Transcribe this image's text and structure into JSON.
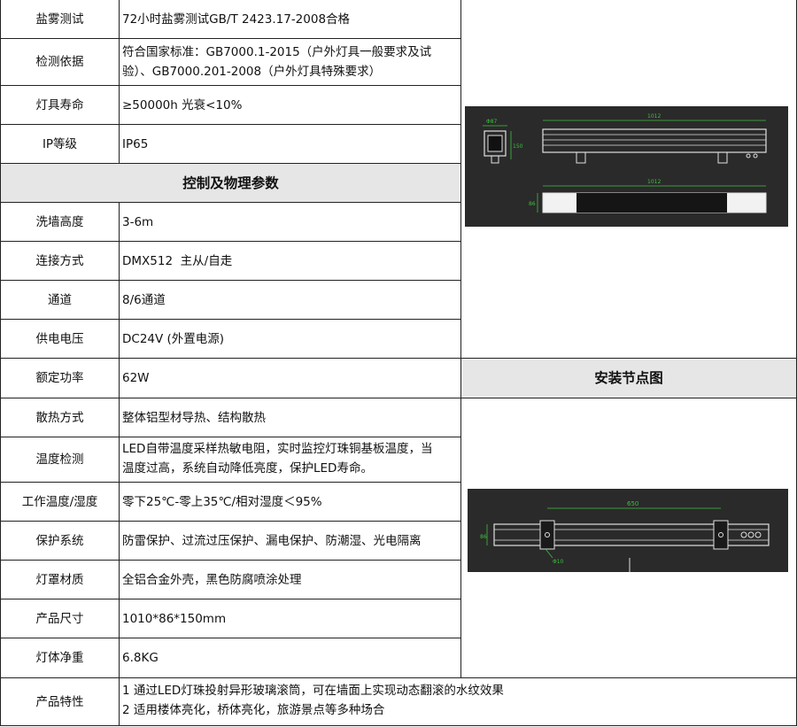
{
  "rows_top": [
    {
      "label": "盐雾测试",
      "value": "72小时盐雾测试GB/T 2423.17-2008合格"
    },
    {
      "label": "检测依据",
      "value_lines": [
        "符合国家标准：GB7000.1-2015（户外灯具一般要求及试",
        "验）、GB7000.201-2008（户外灯具特殊要求）"
      ]
    },
    {
      "label": "灯具寿命",
      "value": "≥50000h 光衰<10%"
    },
    {
      "label": "IP等级",
      "value": "IP65"
    }
  ],
  "section_control": "控制及物理参数",
  "rows_control": [
    {
      "label": "洗墙高度",
      "value": "3-6m"
    },
    {
      "label": "连接方式",
      "value": "DMX512  主从/自走"
    },
    {
      "label": "通道",
      "value": "8/6通道"
    },
    {
      "label": "供电电压",
      "value": "DC24V (外置电源)"
    },
    {
      "label": "额定功率",
      "value": "62W"
    },
    {
      "label": "散热方式",
      "value": "整体铝型材导热、结构散热"
    },
    {
      "label": "温度检测",
      "value_lines": [
        "LED自带温度采样热敏电阻，实时监控灯珠铜基板温度，当",
        "温度过高，系统自动降低亮度，保护LED寿命。"
      ]
    },
    {
      "label": "工作温度/湿度",
      "value": "零下25℃-零上35℃/相对湿度＜95%"
    },
    {
      "label": "保护系统",
      "value": "防雷保护、过流过压保护、漏电保护、防潮湿、光电隔离"
    },
    {
      "label": "灯罩材质",
      "value": "全铝合金外壳，黑色防腐喷涂处理"
    },
    {
      "label": "产品尺寸",
      "value": "1010*86*150mm"
    },
    {
      "label": "灯体净重",
      "value": "6.8KG"
    }
  ],
  "row_features": {
    "label": "产品特性",
    "value_lines": [
      "1 通过LED灯珠投射异形玻璃滚筒，可在墙面上实现动态翻滚的水纹效果",
      "2 适用楼体亮化，桥体亮化，旅游景点等多种场合"
    ]
  },
  "section_install": "安装节点图",
  "drawing1": {
    "dim_width_side": "Φ87",
    "dim_height_side": "150",
    "dim_length_top": "1012",
    "dim_length_bottom": "1012",
    "dim_height_bottom": "86"
  },
  "drawing2": {
    "dim_span": "650",
    "dim_height": "86",
    "dim_hole": "Φ10"
  },
  "colors": {
    "line": "#222222",
    "section_bg": "#e6e6e6",
    "drawing_bg": "#2a2a2a",
    "drawing_line": "#e0e0e0",
    "dim_green": "#3fbf3f"
  }
}
